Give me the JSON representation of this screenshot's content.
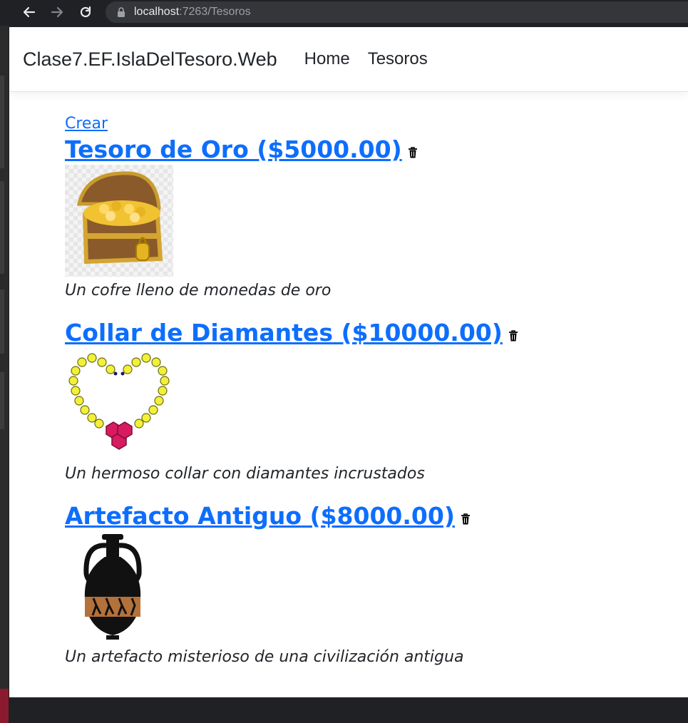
{
  "browser": {
    "url_host": "localhost",
    "url_rest": ":7263/Tesoros"
  },
  "navbar": {
    "brand": "Clase7.EF.IslaDelTesoro.Web",
    "links": [
      "Home",
      "Tesoros"
    ]
  },
  "content": {
    "create_label": "Crear",
    "items": [
      {
        "title": "Tesoro de Oro ($5000.00)",
        "description": "Un cofre lleno de monedas de oro",
        "image": "treasure-chest"
      },
      {
        "title": "Collar de Diamantes ($10000.00)",
        "description": "Un hermoso collar con diamantes incrustados",
        "image": "heart-necklace"
      },
      {
        "title": "Artefacto Antiguo ($8000.00)",
        "description": "Un artefacto misterioso de una civilización antigua",
        "image": "ancient-amphora"
      }
    ]
  },
  "colors": {
    "link": "#0d6efd",
    "text": "#212529",
    "chrome": "#202124"
  }
}
